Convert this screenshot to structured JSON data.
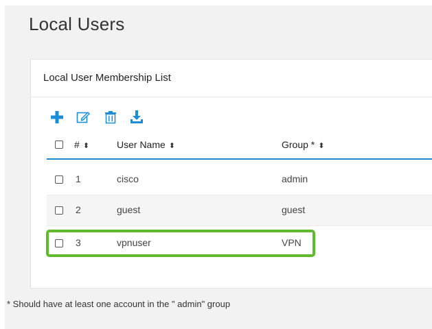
{
  "page": {
    "title": "Local Users"
  },
  "panel": {
    "title": "Local User Membership List"
  },
  "toolbar": {
    "add_icon": "plus-icon",
    "edit_icon": "edit-icon",
    "delete_icon": "trash-icon",
    "import_icon": "download-icon"
  },
  "table": {
    "headers": {
      "index": "#",
      "username": "User Name",
      "group": "Group *"
    },
    "sort_glyph": "⬍",
    "rows": [
      {
        "index": "1",
        "username": "cisco",
        "group": "admin"
      },
      {
        "index": "2",
        "username": "guest",
        "group": "guest"
      },
      {
        "index": "3",
        "username": "vpnuser",
        "group": "VPN"
      }
    ]
  },
  "footnote": "* Should have at least one account in the \" admin\" group",
  "colors": {
    "accent": "#1989d8",
    "highlight": "#5fba2c",
    "icon_blue": "#1b8ed6"
  }
}
